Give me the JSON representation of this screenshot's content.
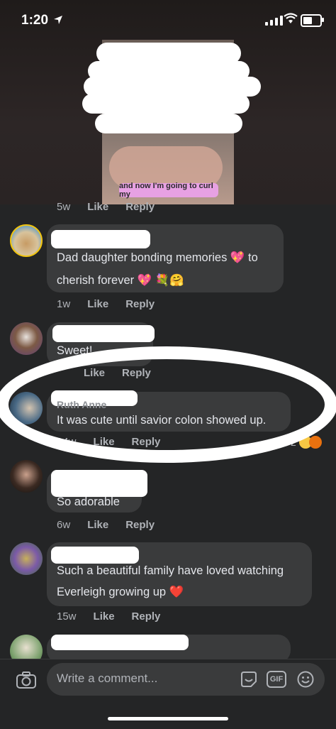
{
  "status": {
    "time": "1:20"
  },
  "video": {
    "caption": "and now I'm going to curl my"
  },
  "actions": {
    "like": "Like",
    "reply": "Reply"
  },
  "comments": [
    {
      "name": "",
      "text_lines": [
        "Dad daughter bonding memories 💖 to",
        "cherish forever 💖 💐🤗"
      ],
      "time": "1w"
    },
    {
      "name": "",
      "text_lines": [
        "Sweet!"
      ],
      "time": ""
    },
    {
      "name": "Ruth Anne",
      "text_lines": [
        "It was cute until savior colon showed up."
      ],
      "time": "14w",
      "reactions": "2"
    },
    {
      "name": "",
      "text_lines": [
        "So adorable"
      ],
      "time": "6w"
    },
    {
      "name": "",
      "text_lines": [
        "Such a beautiful family  have loved watching",
        "Everleigh growing up ❤️"
      ],
      "time": "15w"
    },
    {
      "name": "",
      "text_lines": [],
      "time": ""
    }
  ],
  "prev_meta": {
    "time": "5w"
  },
  "composer": {
    "placeholder": "Write a comment...",
    "gif": "GIF"
  }
}
